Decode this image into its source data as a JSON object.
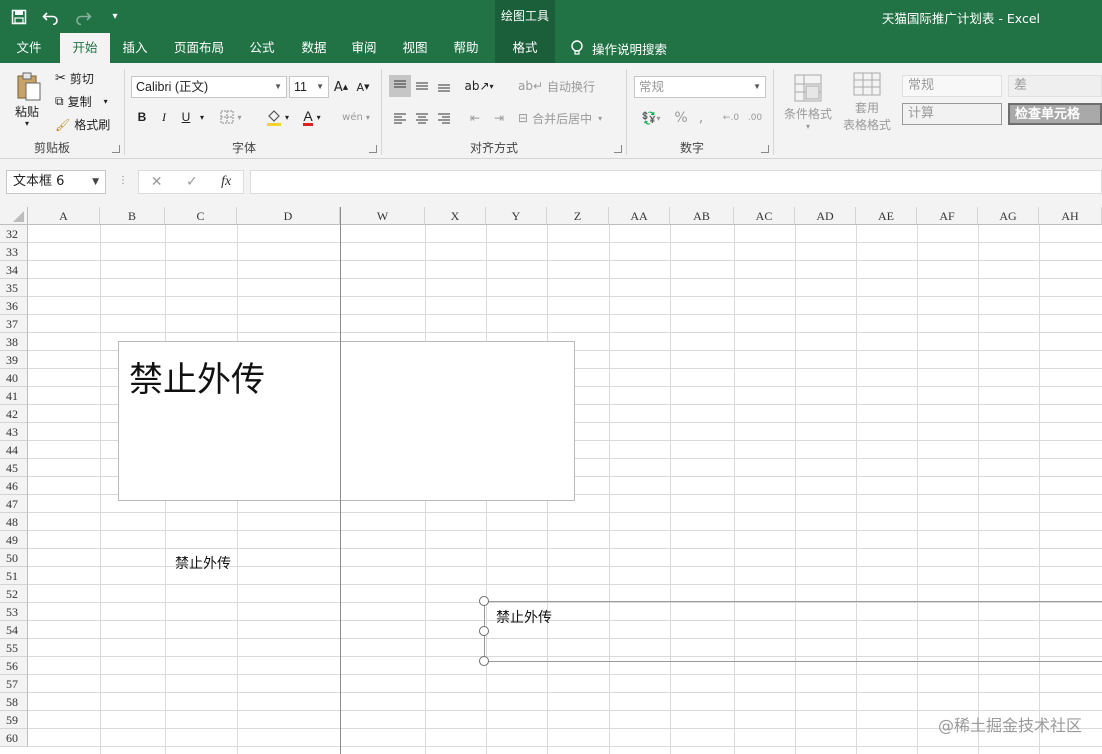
{
  "window": {
    "qat": {
      "save": "save-icon",
      "undo": "undo-icon",
      "redo": "redo-icon",
      "customize": "customize-icon"
    },
    "context_tab_group": "绘图工具",
    "title": "天猫国际推广计划表  -  Excel"
  },
  "tabs": [
    "文件",
    "开始",
    "插入",
    "页面布局",
    "公式",
    "数据",
    "审阅",
    "视图",
    "帮助",
    "格式"
  ],
  "tell_me": "操作说明搜索",
  "ribbon": {
    "clipboard": {
      "paste": "粘贴",
      "cut": "剪切",
      "copy": "复制",
      "format_painter": "格式刷",
      "label": "剪贴板"
    },
    "font": {
      "name": "Calibri (正文)",
      "size": "11",
      "bold": "B",
      "italic": "I",
      "underline": "U",
      "phonetic": "wén",
      "label": "字体"
    },
    "alignment": {
      "wrap": "自动换行",
      "merge": "合并后居中",
      "label": "对齐方式"
    },
    "number": {
      "format": "常规",
      "label": "数字"
    },
    "styles": {
      "conditional": "条件格式",
      "table_line1": "套用",
      "table_line2": "表格格式",
      "normal": "常规",
      "bad": "差",
      "calc": "计算",
      "check": "检查单元格"
    }
  },
  "formula_bar": {
    "name_box": "文本框 6",
    "cancel": "✕",
    "enter": "✓",
    "fx": "fx",
    "value": ""
  },
  "columns": [
    "A",
    "B",
    "C",
    "D",
    "W",
    "X",
    "Y",
    "Z",
    "AA",
    "AB",
    "AC",
    "AD",
    "AE",
    "AF",
    "AG",
    "AH"
  ],
  "rows": [
    "32",
    "33",
    "34",
    "35",
    "36",
    "37",
    "38",
    "39",
    "40",
    "41",
    "42",
    "43",
    "44",
    "45",
    "46",
    "47",
    "48",
    "49",
    "50",
    "51",
    "52",
    "53",
    "54",
    "55",
    "56",
    "57",
    "58",
    "59",
    "60"
  ],
  "sheet": {
    "large_textbox": "禁止外传",
    "cell_text": "禁止外传",
    "selected_textbox": "禁止外传"
  },
  "watermark": "@稀土掘金技术社区"
}
